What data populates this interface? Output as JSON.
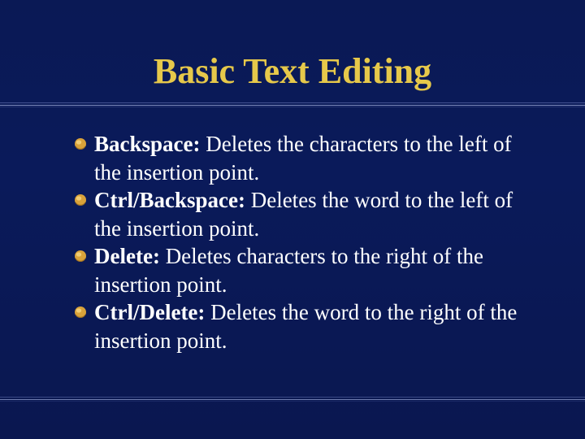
{
  "slide": {
    "title": "Basic Text Editing",
    "items": [
      {
        "label": "Backspace:",
        "desc": "  Deletes the characters to the left of the insertion point."
      },
      {
        "label": "Ctrl/Backspace:",
        "desc": "  Deletes the word to the left of the insertion point."
      },
      {
        "label": "Delete:",
        "desc": "  Deletes characters to the right of the insertion point."
      },
      {
        "label": "Ctrl/Delete:",
        "desc": "  Deletes the word to the right of the insertion point."
      }
    ]
  },
  "colors": {
    "background": "#0a1955",
    "title": "#e6c84a",
    "text": "#ffffff",
    "bullet_fill": "#d9a23a",
    "bullet_shadow": "#7a4e10"
  }
}
